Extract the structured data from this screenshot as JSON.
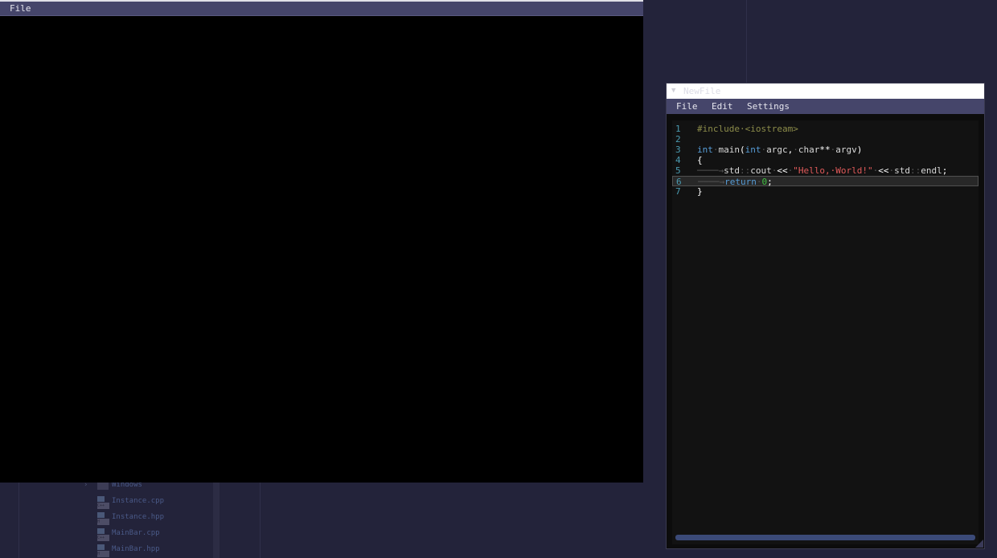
{
  "viewport_window": {
    "menu": [
      "File"
    ]
  },
  "editor_window": {
    "title": "NewFile",
    "menu": [
      "File",
      "Edit",
      "Settings"
    ],
    "current_line": 6,
    "lines": [
      {
        "num": "1",
        "tokens": [
          {
            "t": "#include·<iostream>",
            "c": "pre"
          }
        ]
      },
      {
        "num": "2",
        "tokens": []
      },
      {
        "num": "3",
        "tokens": [
          {
            "t": "int",
            "c": "kw"
          },
          {
            "t": "·",
            "c": "ws"
          },
          {
            "t": "main",
            "c": "id"
          },
          {
            "t": "(",
            "c": "punct"
          },
          {
            "t": "int",
            "c": "kw"
          },
          {
            "t": "·",
            "c": "ws"
          },
          {
            "t": "argc",
            "c": "id"
          },
          {
            "t": ",",
            "c": "punct"
          },
          {
            "t": "·",
            "c": "ws"
          },
          {
            "t": "char",
            "c": "id"
          },
          {
            "t": "**",
            "c": "punct"
          },
          {
            "t": "·",
            "c": "ws"
          },
          {
            "t": "argv",
            "c": "id"
          },
          {
            "t": ")",
            "c": "punct"
          }
        ]
      },
      {
        "num": "4",
        "tokens": [
          {
            "t": "{",
            "c": "punct"
          }
        ]
      },
      {
        "num": "5",
        "tokens": [
          {
            "t": "────→",
            "c": "ws"
          },
          {
            "t": "std",
            "c": "id"
          },
          {
            "t": "::",
            "c": "ws"
          },
          {
            "t": "cout",
            "c": "id"
          },
          {
            "t": "·",
            "c": "ws"
          },
          {
            "t": "<<",
            "c": "punct"
          },
          {
            "t": "·",
            "c": "ws"
          },
          {
            "t": "\"Hello,·World!\"",
            "c": "str"
          },
          {
            "t": "·",
            "c": "ws"
          },
          {
            "t": "<<",
            "c": "punct"
          },
          {
            "t": "·",
            "c": "ws"
          },
          {
            "t": "std",
            "c": "id"
          },
          {
            "t": "::",
            "c": "ws"
          },
          {
            "t": "endl",
            "c": "id"
          },
          {
            "t": ";",
            "c": "punct"
          }
        ]
      },
      {
        "num": "6",
        "tokens": [
          {
            "t": "────→",
            "c": "ws"
          },
          {
            "t": "return",
            "c": "kw"
          },
          {
            "t": "·",
            "c": "ws"
          },
          {
            "t": "0",
            "c": "num"
          },
          {
            "t": ";",
            "c": "punct"
          }
        ]
      },
      {
        "num": "7",
        "tokens": [
          {
            "t": "}",
            "c": "punct"
          }
        ]
      }
    ]
  },
  "file_tree": [
    {
      "kind": "folder",
      "label": "Windows",
      "expanded": false
    },
    {
      "kind": "file",
      "label": "Instance.cpp",
      "badge": "C++"
    },
    {
      "kind": "file",
      "label": "Instance.hpp",
      "badge": "H"
    },
    {
      "kind": "file",
      "label": "MainBar.cpp",
      "badge": "C++"
    },
    {
      "kind": "file",
      "label": "MainBar.hpp",
      "badge": "H"
    }
  ],
  "colors": {
    "menubar": "#45456a",
    "keyword": "#569cd6",
    "string": "#e05a5a",
    "number": "#40c040",
    "preprocessor": "#8c8c4a",
    "line_number": "#4a9ab0"
  }
}
